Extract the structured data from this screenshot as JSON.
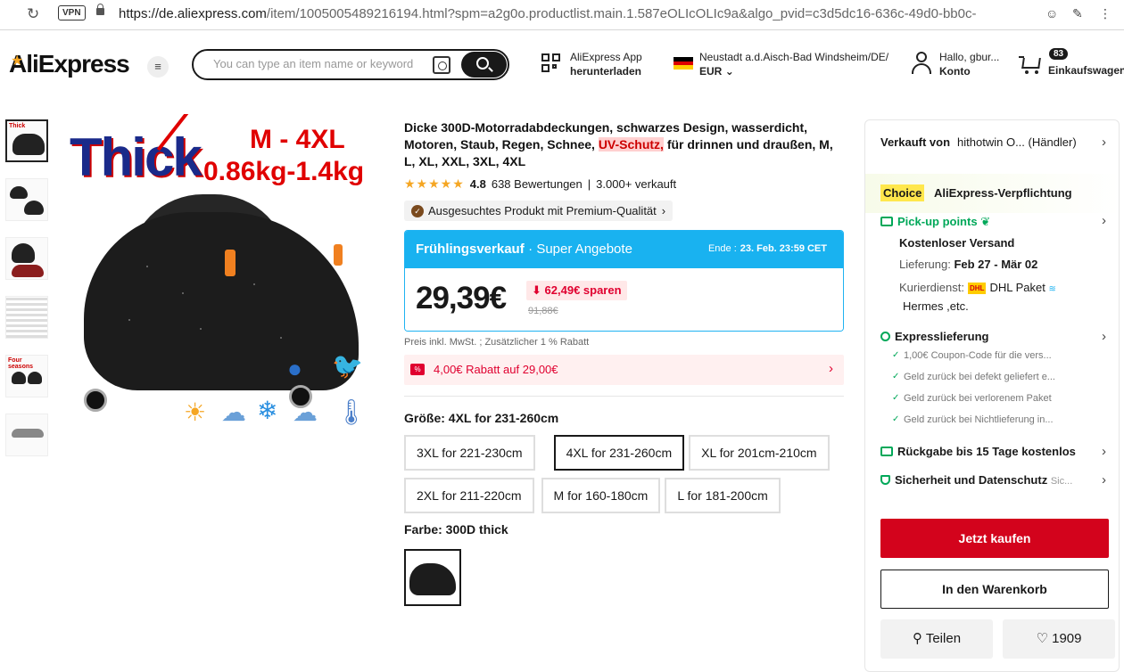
{
  "browser": {
    "vpn": "VPN",
    "url_host": "https://de.aliexpress.com",
    "url_path": "/item/1005005489216194.html?spm=a2g0o.productlist.main.1.587eOLIcOLIc9a&algo_pvid=c3d5dc16-636c-49d0-bb0c-"
  },
  "header": {
    "logo": "AliExpress",
    "search_placeholder": "You can type an item name or keyword",
    "app_line1": "AliExpress App",
    "app_line2": "herunterladen",
    "locale_line1": "Neustadt a.d.Aisch-Bad Windsheim/DE/",
    "locale_line2": "EUR",
    "account_line1": "Hallo, gbur...",
    "account_line2": "Konto",
    "cart_count": "83",
    "cart_label": "Einkaufswagen"
  },
  "gallery": {
    "main_text_thick": "Thick",
    "main_text_size": "M  -  4XL",
    "main_text_weight": "0.86kg-1.4kg",
    "thumb_labels": [
      "Thick",
      "",
      "",
      "",
      "Four seasons",
      ""
    ]
  },
  "product": {
    "title_part1": "Dicke 300D-Motorradabdeckungen, schwarzes Design, wasserdicht, Motoren, Staub, Regen, Schnee, ",
    "title_highlight": "UV-Schutz,",
    "title_part2": " für drinnen und draußen, M, L, XL, XXL, 3XL, 4XL",
    "stars": "★★★★★",
    "rating": "4.8",
    "reviews": "638 Bewertungen",
    "sold": "3.000+ verkauft",
    "premium_label": "Ausgesuchtes Produkt mit Premium-Qualität",
    "sale_title": "Frühlingsverkauf",
    "sale_subtitle": "· Super Angebote",
    "sale_end_label": "Ende :",
    "sale_end_date": "23. Feb. 23:59 CET",
    "price": "29,39€",
    "savings": "62,49€ sparen",
    "old_price": "91,88€",
    "tax_note": "Preis inkl. MwSt. ; Zusätzlicher 1 % Rabatt",
    "coupon_text": "4,00€ Rabatt auf 29,00€",
    "size_label": "Größe: 4XL for 231-260cm",
    "sizes": [
      "3XL for 221-230cm",
      "4XL for 231-260cm",
      "XL for 201cm-210cm",
      "2XL for 211-220cm",
      "M for 160-180cm",
      "L for 181-200cm"
    ],
    "selected_size_index": 1,
    "color_label": "Farbe: 300D thick"
  },
  "panel": {
    "seller_label": "Verkauft von",
    "seller_name": "hithotwin O... (Händler)",
    "choice_tag": "Choice",
    "choice_text": "AliExpress-Verpflichtung",
    "pickup": "Pick-up points",
    "free_shipping": "Kostenloser Versand",
    "delivery_label": "Lieferung:",
    "delivery_dates": "Feb 27 - Mär 02",
    "courier_label": "Kurierdienst:",
    "courier_name": "DHL Paket",
    "courier_more": "Hermes ,etc.",
    "express": "Expresslieferung",
    "express_items": [
      "1,00€ Coupon-Code für die vers...",
      "Geld zurück bei defekt geliefert e...",
      "Geld zurück bei verlorenem Paket",
      "Geld zurück bei Nichtlieferung in..."
    ],
    "returns": "Rückgabe bis 15 Tage kostenlos",
    "security": "Sicherheit und Datenschutz",
    "security_more": "Sic...",
    "buy_now": "Jetzt kaufen",
    "add_to_cart": "In den Warenkorb",
    "share": "Teilen",
    "wishlist_count": "1909"
  },
  "colors": {
    "accent_red": "#d3031c",
    "sale_blue": "#19b2f0",
    "green": "#00a859",
    "choice_yellow": "#ffe74c"
  }
}
